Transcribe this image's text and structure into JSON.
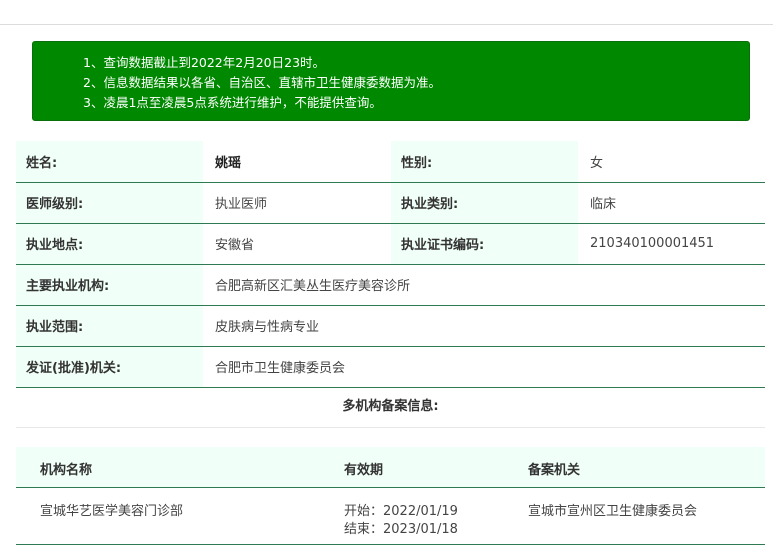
{
  "notice": {
    "lines": [
      "1、查询数据截止到2022年2月20日23时。",
      "2、信息数据结果以各省、自治区、直辖市卫生健康委数据为准。",
      "3、凌晨1点至凌晨5点系统进行维护，不能提供查询。"
    ]
  },
  "doctor": {
    "name_label": "姓名:",
    "name": "姚瑶",
    "gender_label": "性别:",
    "gender": "女",
    "level_label": "医师级别:",
    "level": "执业医师",
    "category_label": "执业类别:",
    "category": "临床",
    "location_label": "执业地点:",
    "location": "安徽省",
    "cert_label": "执业证书编码:",
    "cert_no": "210340100001451",
    "institution_label": "主要执业机构:",
    "institution": "合肥高新区汇美丛生医疗美容诊所",
    "scope_label": "执业范围:",
    "scope": "皮肤病与性病专业",
    "issuer_label": "发证(批准)机关:",
    "issuer": "合肥市卫生健康委员会"
  },
  "multi": {
    "title": "多机构备案信息:",
    "headers": [
      "机构名称",
      "有效期",
      "备案机关"
    ],
    "rows": [
      {
        "name": "宣城华艺医学美容门诊部",
        "start": "开始：2022/01/19",
        "end": "结束：2023/01/18",
        "authority": "宣城市宣州区卫生健康委员会"
      }
    ]
  },
  "colors": {
    "notice_bg": "#008800",
    "label_bg": "#f0fff7",
    "rule": "#2e7a53"
  }
}
